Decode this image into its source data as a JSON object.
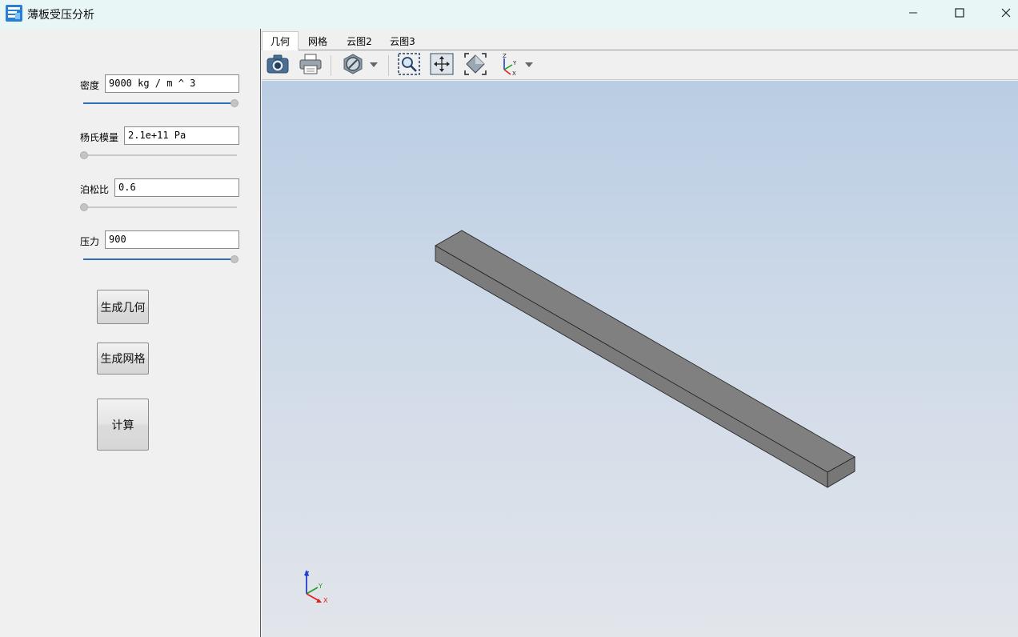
{
  "window": {
    "title": "薄板受压分析",
    "icon": "app-icon",
    "controls": [
      "minimize-icon",
      "maximize-icon",
      "close-icon"
    ]
  },
  "params": {
    "density": {
      "label": "密度",
      "value": "9000 kg / m ^ 3",
      "slider_fraction": 1.0
    },
    "youngs": {
      "label": "杨氏模量",
      "value": "2.1e+11 Pa",
      "slider_fraction": 0.0
    },
    "poisson": {
      "label": "泊松比",
      "value": "0.6",
      "slider_fraction": 0.0
    },
    "pressure": {
      "label": "压力",
      "value": "900",
      "slider_fraction": 1.0
    }
  },
  "buttons": {
    "generate_geometry": "生成几何",
    "generate_mesh": "生成网格",
    "compute": "计算"
  },
  "tabs": [
    {
      "label": "几何",
      "active": true
    },
    {
      "label": "网格",
      "active": false
    },
    {
      "label": "云图2",
      "active": false
    },
    {
      "label": "云图3",
      "active": false
    }
  ],
  "toolbar": {
    "icons": [
      "camera-icon",
      "print-icon",
      "display-mode-icon",
      "zoom-window-icon",
      "pan-icon",
      "fit-all-icon",
      "view-axes-icon"
    ]
  },
  "viewport": {
    "axes_labels": {
      "x": "X",
      "y": "Y",
      "z": "Z"
    },
    "colors": {
      "body": "#808080",
      "x_axis": "#e02020",
      "y_axis": "#20a020",
      "z_axis": "#2040d0"
    }
  }
}
